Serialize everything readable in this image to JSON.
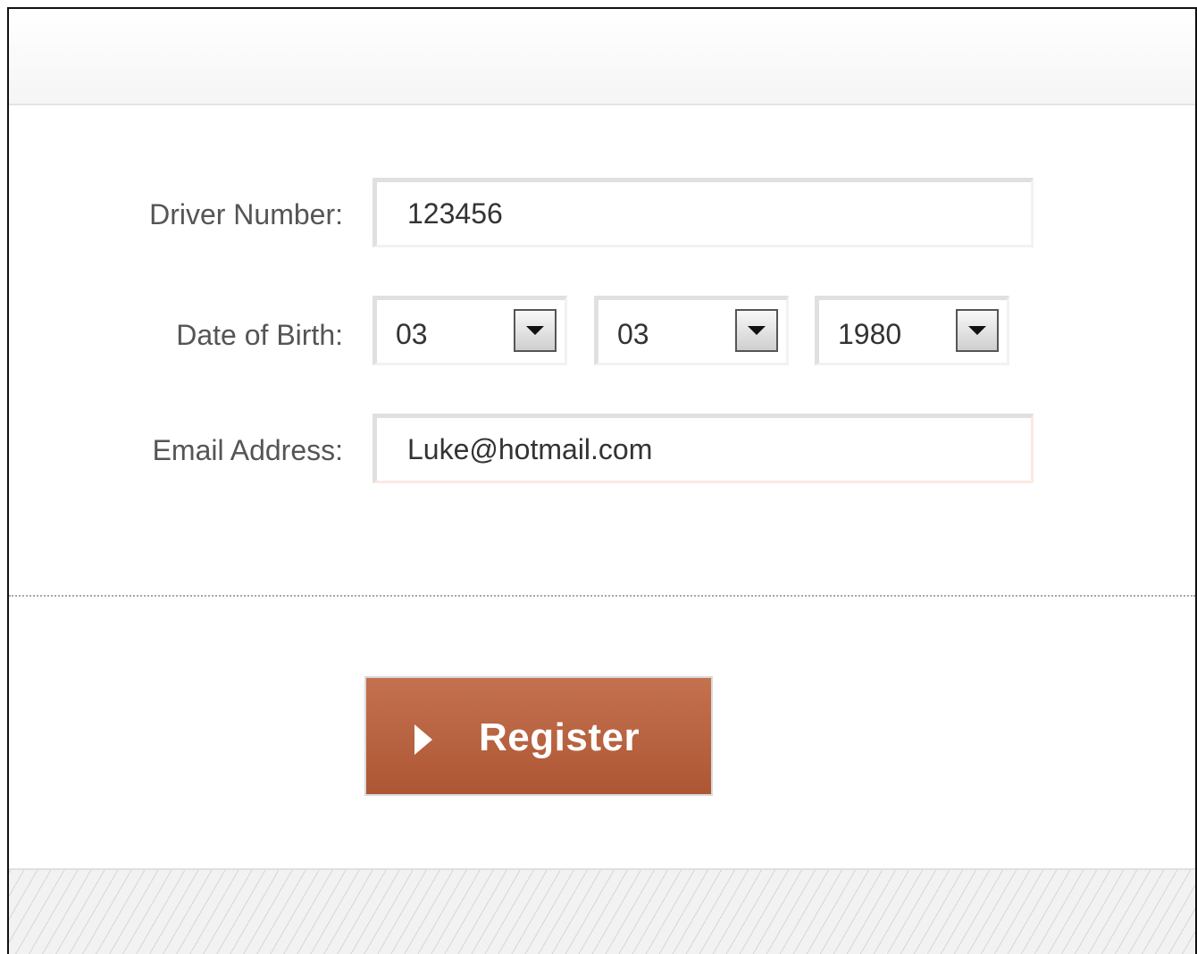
{
  "form": {
    "driver_number": {
      "label": "Driver Number:",
      "value": "123456"
    },
    "date_of_birth": {
      "label": "Date of Birth:",
      "day": "03",
      "month": "03",
      "year": "1980"
    },
    "email": {
      "label": "Email Address:",
      "value": "Luke@hotmail.com"
    }
  },
  "actions": {
    "register_label": "Register",
    "register_icon": "play-icon"
  },
  "colors": {
    "button_top": "#c4714f",
    "button_bottom": "#ad5634",
    "label_text": "#555555"
  }
}
